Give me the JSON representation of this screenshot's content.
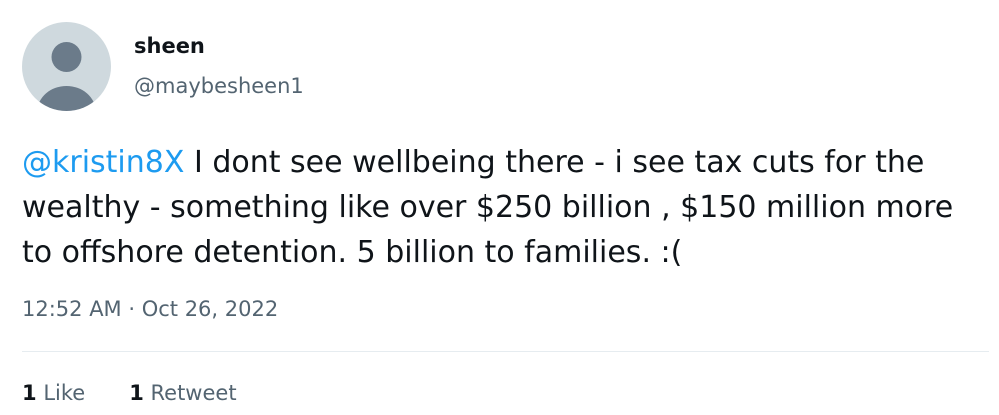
{
  "user": {
    "display_name": "sheen",
    "handle": "@maybesheen1"
  },
  "tweet": {
    "mention": "@kristin8X",
    "text": " I dont see wellbeing there - i see tax cuts for the wealthy - something like over $250 billion , $150 million more to offshore detention. 5 billion to families. :(",
    "timestamp": "12:52 AM · Oct 26, 2022"
  },
  "stats": {
    "likes_count": "1",
    "likes_label": "Like",
    "retweets_count": "1",
    "retweets_label": "Retweet"
  },
  "colors": {
    "mention": "#1d9bf0",
    "secondary_text": "#536471",
    "avatar_bg": "#cfd9de",
    "avatar_figure": "#6b7b8a"
  },
  "icons": {
    "avatar": "default-profile-avatar-icon"
  }
}
